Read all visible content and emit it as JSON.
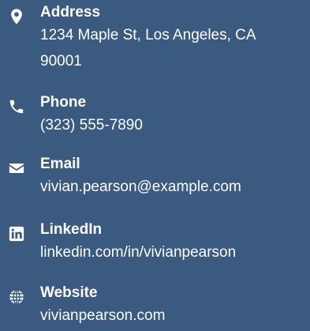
{
  "contact": {
    "address": {
      "icon": "map-marker-icon",
      "label": "Address",
      "value": "1234 Maple St, Los Angeles, CA 90001"
    },
    "phone": {
      "icon": "phone-icon",
      "label": "Phone",
      "value": "(323) 555-7890"
    },
    "email": {
      "icon": "envelope-icon",
      "label": "Email",
      "value": "vivian.pearson@example.com"
    },
    "linkedin": {
      "icon": "linkedin-icon",
      "label": "LinkedIn",
      "value": "linkedin.com/in/vivianpearson"
    },
    "website": {
      "icon": "globe-icon",
      "label": "Website",
      "value": "vivianpearson.com"
    }
  },
  "colors": {
    "background": "#3a5a80",
    "text": "#ffffff"
  }
}
